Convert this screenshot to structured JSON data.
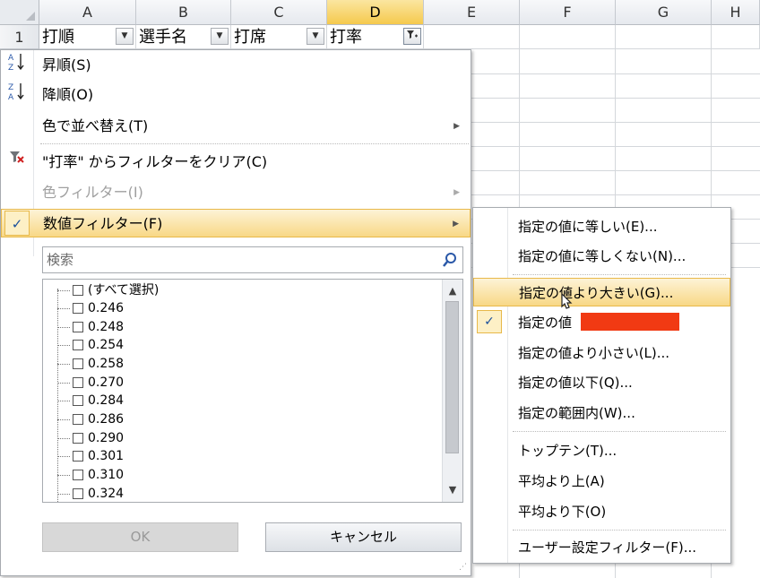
{
  "sheet": {
    "columns": [
      "A",
      "B",
      "C",
      "D",
      "E",
      "F",
      "G",
      "H"
    ],
    "row1_number": "1",
    "headers": [
      "打順",
      "選手名",
      "打席",
      "打率"
    ]
  },
  "menu": {
    "sort_asc": "昇順(S)",
    "sort_desc": "降順(O)",
    "sort_by_color": "色で並べ替え(T)",
    "clear_filter": "\"打率\" からフィルターをクリア(C)",
    "color_filter": "色フィルター(I)",
    "number_filter": "数値フィルター(F)",
    "search_placeholder": "検索",
    "list_items": [
      "(すべて選択)",
      "0.246",
      "0.248",
      "0.254",
      "0.258",
      "0.270",
      "0.284",
      "0.286",
      "0.290",
      "0.301",
      "0.310",
      "0.324"
    ],
    "ok_label": "OK",
    "cancel_label": "キャンセル"
  },
  "submenu": {
    "equals": "指定の値に等しい(E)...",
    "not_equals": "指定の値に等しくない(N)...",
    "greater_than": "指定の値より大きい(G)...",
    "greater_or_equal": "指定の値",
    "less_than": "指定の値より小さい(L)...",
    "less_or_equal": "指定の値以下(Q)...",
    "between": "指定の範囲内(W)...",
    "top_ten": "トップテン(T)...",
    "above_average": "平均より上(A)",
    "below_average": "平均より下(O)",
    "custom_filter": "ユーザー設定フィルター(F)..."
  },
  "colors": {
    "highlight": "#f8d886",
    "redaction": "#f13a13",
    "selected_column": "#f5c94d"
  }
}
